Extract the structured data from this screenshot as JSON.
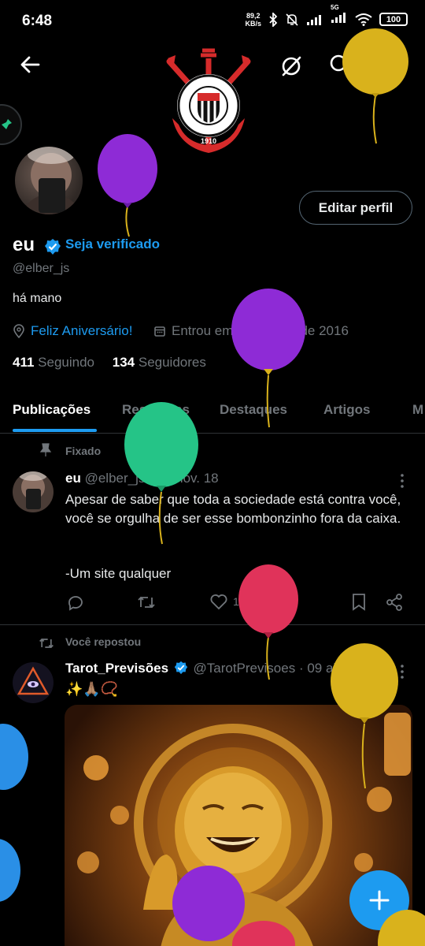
{
  "status": {
    "time": "6:48",
    "net_speed_value": "89,2",
    "net_speed_unit": "KB/s",
    "network": "5G",
    "battery": "100"
  },
  "header": {
    "back_icon": "arrow-left-icon",
    "logo_text": "S.C. CORINTHIANS PAULISTA",
    "logo_year": "1910"
  },
  "profile": {
    "edit_label": "Editar perfil",
    "name": "eu",
    "verify_label": "Seja verificado",
    "handle": "@elber_js",
    "bio": "há mano",
    "birthday": "Feliz Aniversário!",
    "joined": "Entrou em dezembro de 2016",
    "following_count": "411",
    "following_label": "Seguindo",
    "followers_count": "134",
    "followers_label": "Seguidores"
  },
  "tabs": [
    "Publicações",
    "Respostas",
    "Destaques",
    "Artigos",
    "M"
  ],
  "pinned": {
    "label": "Fixado",
    "name": "eu",
    "handle": "@elber_js",
    "date": "· 16 nov. 18",
    "text1": "Apesar de saber que toda a sociedade está contra você, você se orgulha de ser esse bombonzinho fora da caixa.",
    "text2": "-Um site qualquer",
    "likes": "1"
  },
  "repost": {
    "label": "Você repostou",
    "name": "Tarot_Previsões",
    "handle": "@TarotPrevisoes",
    "date": "· 09 abr.",
    "text": "✨🙏🏽📿"
  },
  "colors": {
    "accent": "#1d9bf0",
    "balloon_purple": "#8e2bd6",
    "balloon_gold": "#d9b21c",
    "balloon_green": "#25c487",
    "balloon_red": "#e0335a",
    "balloon_blue": "#2a8fe6"
  }
}
